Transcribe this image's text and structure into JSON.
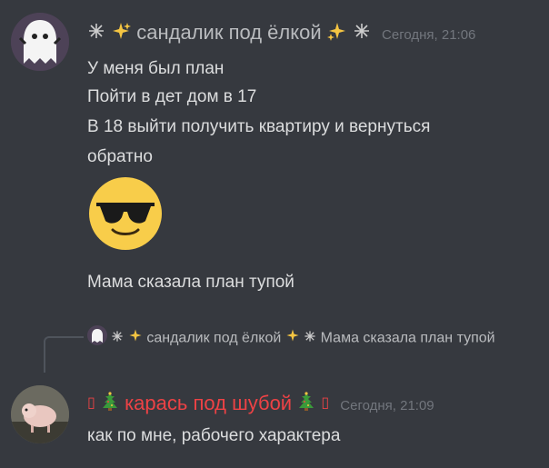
{
  "message1": {
    "author_name": "сандалик под ёлкой",
    "timestamp": "Сегодня, 21:06",
    "lines": [
      "У меня был план",
      "Пойти в дет дом в 17",
      "В 18 выйти получить квартиру и вернуться",
      "обратно"
    ],
    "emoji": "sunglasses-emoji",
    "last_line": "Мама сказала план тупой"
  },
  "reply": {
    "author_name": "сандалик под ёлкой",
    "text": "Мама сказала план тупой"
  },
  "message2": {
    "author_name": "карась под шубой",
    "tofu": "▯",
    "timestamp": "Сегодня, 21:09",
    "text": "как по мне, рабочего характера"
  },
  "colors": {
    "background": "#36393f",
    "text": "#dcddde",
    "muted": "#72767d",
    "author2": "#ed4245",
    "sparkle": "#f5c542"
  }
}
